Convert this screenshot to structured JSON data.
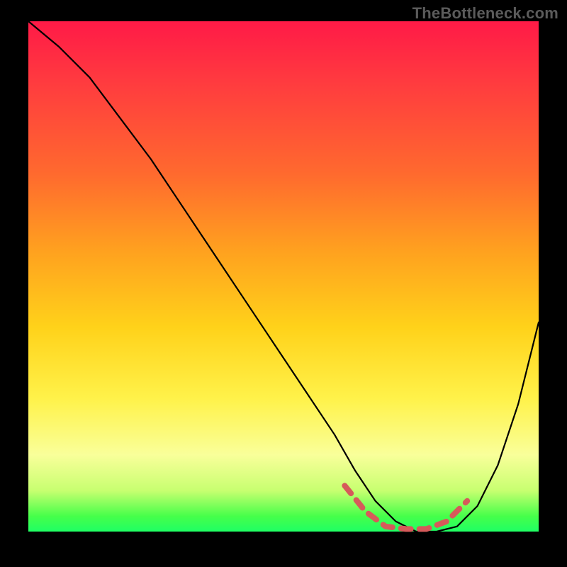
{
  "watermark": "TheBottleneck.com",
  "chart_data": {
    "type": "line",
    "title": "",
    "xlabel": "",
    "ylabel": "",
    "xlim": [
      0,
      100
    ],
    "ylim": [
      0,
      100
    ],
    "series": [
      {
        "name": "bottleneck-curve",
        "x": [
          0,
          6,
          12,
          18,
          24,
          30,
          36,
          42,
          48,
          54,
          60,
          64,
          68,
          72,
          76,
          80,
          84,
          88,
          92,
          96,
          100
        ],
        "values": [
          100,
          95,
          89,
          81,
          73,
          64,
          55,
          46,
          37,
          28,
          19,
          12,
          6,
          2,
          0,
          0,
          1,
          5,
          13,
          25,
          41
        ]
      },
      {
        "name": "optimal-range-marker",
        "x": [
          62,
          66,
          70,
          74,
          78,
          82,
          86
        ],
        "values": [
          9,
          4,
          1,
          0.5,
          0.5,
          2,
          6
        ]
      }
    ],
    "gradient_bands": {
      "description": "vertical background bands from high bottleneck (top) to low (bottom)",
      "stops_percent_color": [
        [
          0,
          "#ff1a47"
        ],
        [
          30,
          "#ff6a2e"
        ],
        [
          60,
          "#ffd21a"
        ],
        [
          85,
          "#f9ff9a"
        ],
        [
          100,
          "#1fff64"
        ]
      ]
    }
  }
}
